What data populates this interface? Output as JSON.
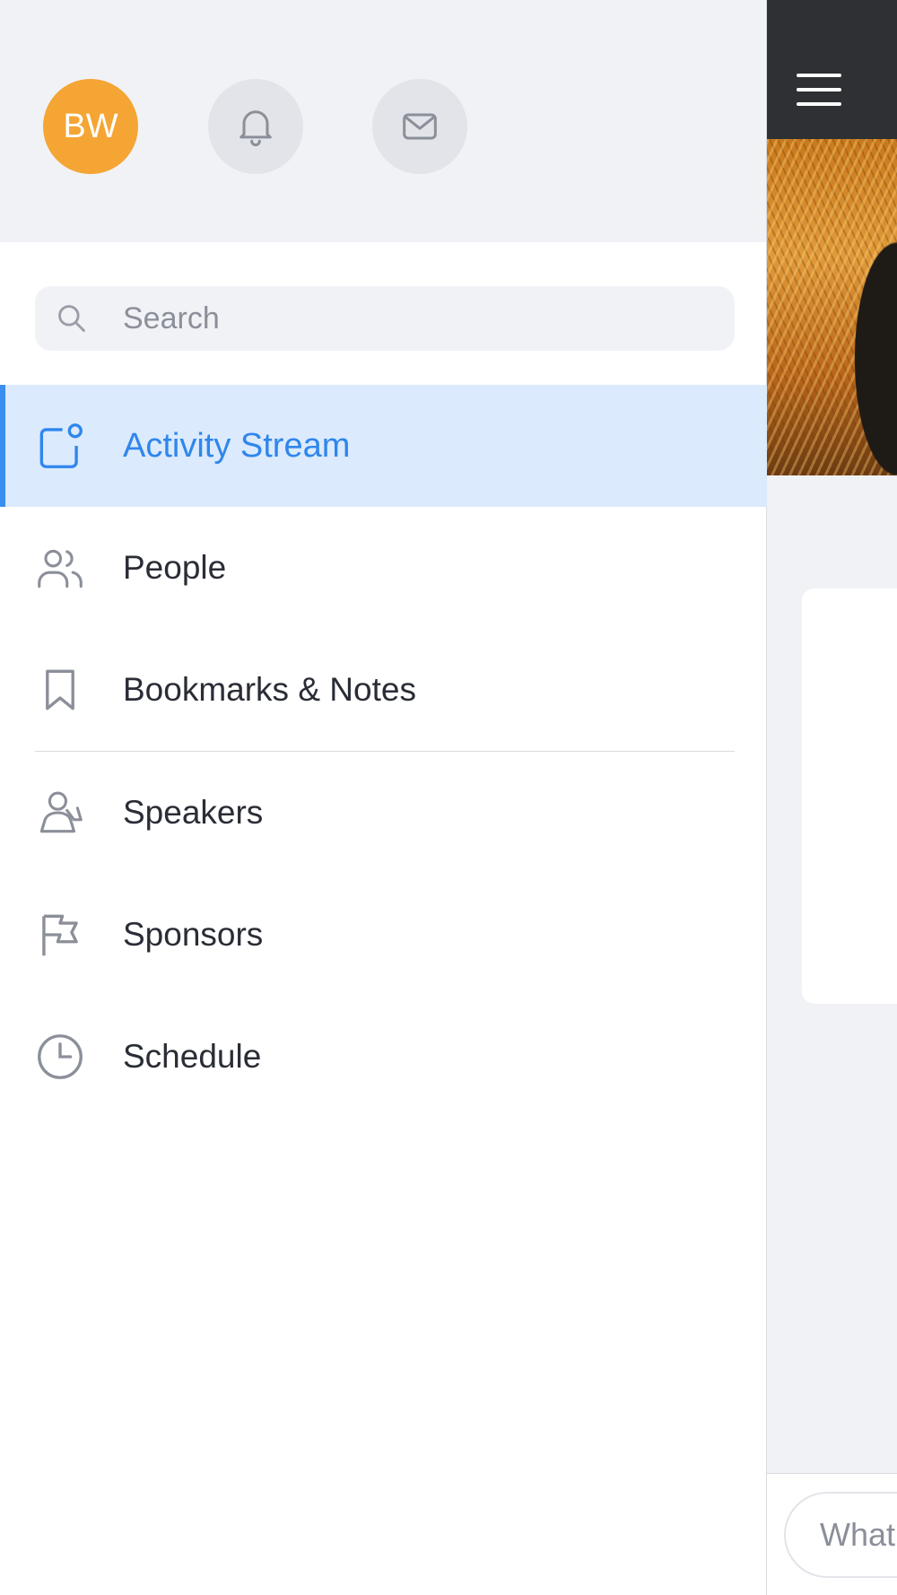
{
  "header": {
    "avatar_initials": "BW",
    "avatar_color": "#f5a533",
    "notifications_icon": "bell-icon",
    "messages_icon": "envelope-icon"
  },
  "search": {
    "placeholder": "Search",
    "value": "",
    "icon": "search-icon"
  },
  "nav": {
    "items": [
      {
        "label": "Activity Stream",
        "icon": "activity-stream-icon",
        "active": true
      },
      {
        "label": "People",
        "icon": "people-icon",
        "active": false
      },
      {
        "label": "Bookmarks & Notes",
        "icon": "bookmark-icon",
        "active": false
      },
      {
        "label": "Speakers",
        "icon": "speakers-icon",
        "active": false
      },
      {
        "label": "Sponsors",
        "icon": "flag-icon",
        "active": false
      },
      {
        "label": "Schedule",
        "icon": "clock-icon",
        "active": false
      }
    ]
  },
  "background_app": {
    "menu_icon": "hamburger-icon",
    "composer_placeholder": "What"
  },
  "colors": {
    "accent": "#2f86ec",
    "active_bg": "#dbeafc",
    "header_bg": "#f1f2f6",
    "icon_gray": "#8b8f99"
  }
}
